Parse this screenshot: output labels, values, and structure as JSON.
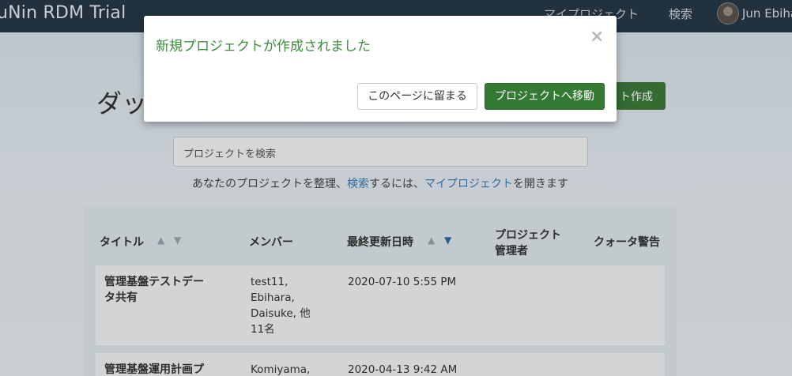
{
  "navbar": {
    "brand": "uNin RDM Trial",
    "my_projects": "マイプロジェクト",
    "search": "検索",
    "user": "Jun Ebihara"
  },
  "dashboard": {
    "title": "ダッシュボード",
    "create_button": "ト作成",
    "search_placeholder": "プロジェクトを検索",
    "help_prefix": "あなたのプロジェクトを整理、",
    "help_search_link": "検索",
    "help_middle": "するには、",
    "help_myprojects_link": "マイプロジェクト",
    "help_suffix": "を開きます"
  },
  "table": {
    "headers": {
      "title": "タイトル",
      "members": "メンバー",
      "last_updated": "最終更新日時",
      "manager_line1": "プロジェクト",
      "manager_line2": "管理者",
      "quota": "クォータ警告"
    },
    "sort_icons": {
      "asc": "▲",
      "desc": "▼"
    },
    "rows": [
      {
        "title_line1": "管理基盤テストデー",
        "title_line2": "タ共有",
        "members": [
          "test11,",
          "Ebihara,",
          "Daisuke, 他",
          "11名"
        ],
        "updated": "2020-07-10 5:55 PM"
      },
      {
        "title_line1": "管理基盤運用計画プ",
        "members": [
          "Komiyama,"
        ],
        "updated": "2020-04-13 9:42 AM"
      }
    ]
  },
  "modal": {
    "title": "新規プロジェクトが作成されました",
    "close_icon": "×",
    "stay_button": "このページに留まる",
    "go_button": "プロジェクトへ移動"
  },
  "colors": {
    "navbar": "#263947",
    "primary_green": "#347a34",
    "title_green": "#3d8b3d",
    "link_blue": "#3a79b3"
  }
}
